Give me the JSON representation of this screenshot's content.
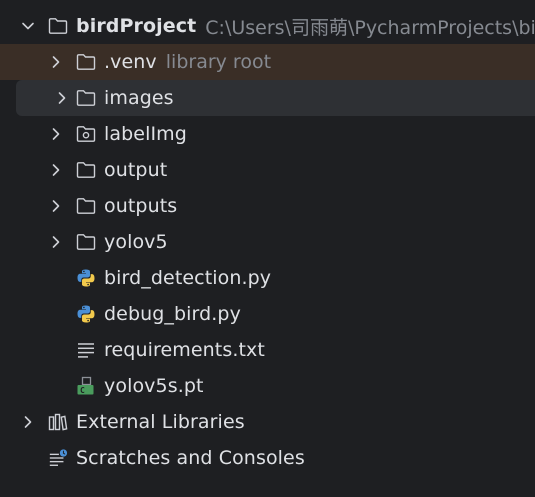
{
  "project": {
    "name": "birdProject",
    "path": "C:\\Users\\司雨萌\\PycharmProjects\\bird",
    "icon": "folder-icon",
    "state": "expanded"
  },
  "items": [
    {
      "label": "venv",
      "prefix": ".",
      "hint": "library root",
      "icon": "folder-icon",
      "expandable": true
    },
    {
      "label": "images",
      "icon": "folder-icon",
      "expandable": true,
      "selected": true
    },
    {
      "label": "labelImg",
      "icon": "module-folder-icon",
      "expandable": true
    },
    {
      "label": "output",
      "icon": "folder-icon",
      "expandable": true
    },
    {
      "label": "outputs",
      "icon": "folder-icon",
      "expandable": true
    },
    {
      "label": "yolov5",
      "icon": "folder-icon",
      "expandable": true
    },
    {
      "label": "bird_detection.py",
      "icon": "python-file-icon",
      "expandable": false
    },
    {
      "label": "debug_bird.py",
      "icon": "python-file-icon",
      "expandable": false
    },
    {
      "label": "requirements.txt",
      "icon": "text-file-icon",
      "expandable": false
    },
    {
      "label": "yolov5s.pt",
      "icon": "binary-file-icon",
      "expandable": false
    }
  ],
  "external_libraries": {
    "label": "External Libraries",
    "icon": "library-icon"
  },
  "scratches": {
    "label": "Scratches and Consoles",
    "icon": "scratches-icon"
  },
  "colors": {
    "background": "#1e1f22",
    "selected_row": "#2e3034",
    "venv_row": "#3a2e26",
    "text": "#dfe1e5",
    "muted": "#868a91",
    "python_blue": "#4a8fd6",
    "python_yellow": "#f2c94c",
    "pt_green": "#4a9c5d"
  }
}
